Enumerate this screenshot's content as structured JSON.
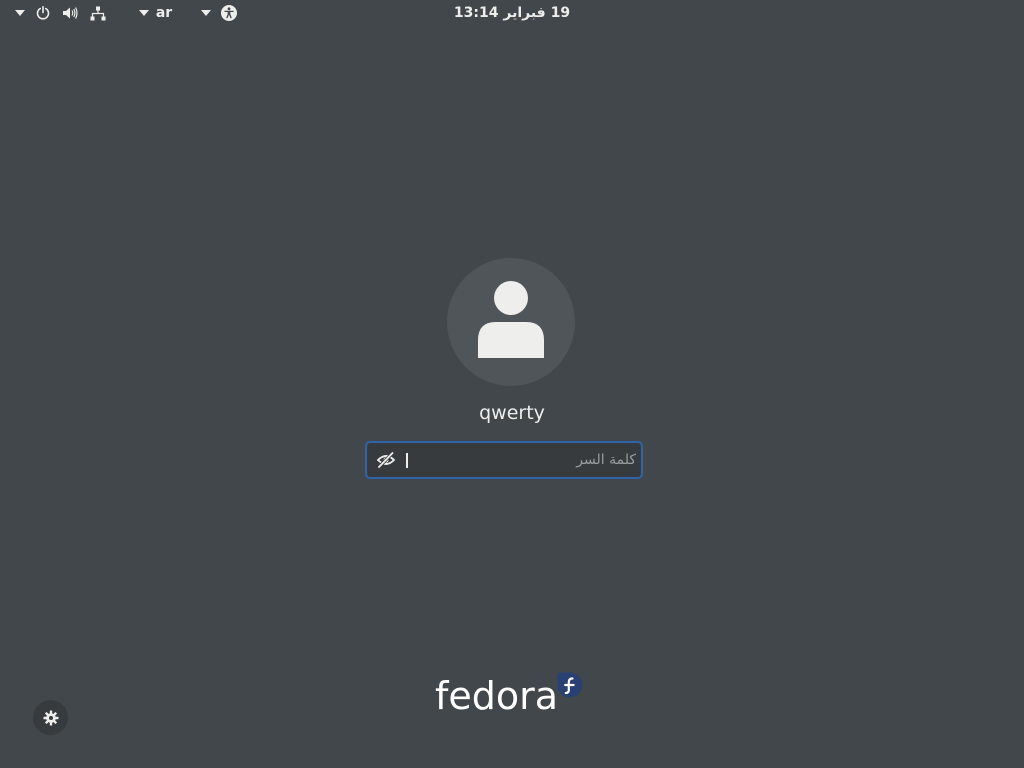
{
  "topbar": {
    "clock": "19 فبراير 13:14",
    "language": "ar",
    "icons": [
      "system-menu-arrow",
      "power-icon",
      "volume-icon",
      "network-icon",
      "language-arrow",
      "accessibility-arrow",
      "accessibility-icon"
    ]
  },
  "login": {
    "username": "qwerty",
    "password_placeholder": "كلمة السر",
    "password_value": ""
  },
  "branding": {
    "logo_text": "fedora"
  },
  "colors": {
    "background": "#41474a",
    "accent": "#2f64a8",
    "entry_bg": "#373b3e",
    "text": "#eeeeec"
  }
}
